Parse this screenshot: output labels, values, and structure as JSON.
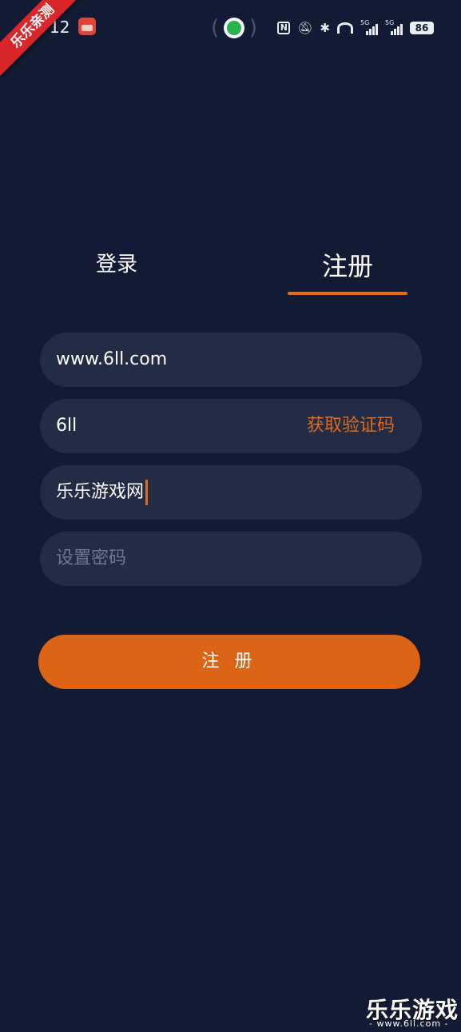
{
  "status_bar": {
    "time": "12",
    "battery": "86",
    "signal_tag_1": "5G",
    "signal_tag_2": "5G",
    "nfc_label": "N"
  },
  "ribbon": {
    "text": "乐乐亲测"
  },
  "tabs": {
    "login": "登录",
    "register": "注册",
    "active": "register"
  },
  "form": {
    "website_value": "www.6ll.com",
    "code_value": "6ll",
    "get_code_label": "获取验证码",
    "nickname_value": "乐乐游戏网",
    "password_placeholder": "设置密码"
  },
  "submit": {
    "label": "注 册"
  },
  "watermark": {
    "title": "乐乐游戏",
    "url": "- www.6ll.com -"
  },
  "colors": {
    "background": "#121b33",
    "field": "#222c45",
    "accent": "#e06b1b",
    "button": "#db6514"
  }
}
